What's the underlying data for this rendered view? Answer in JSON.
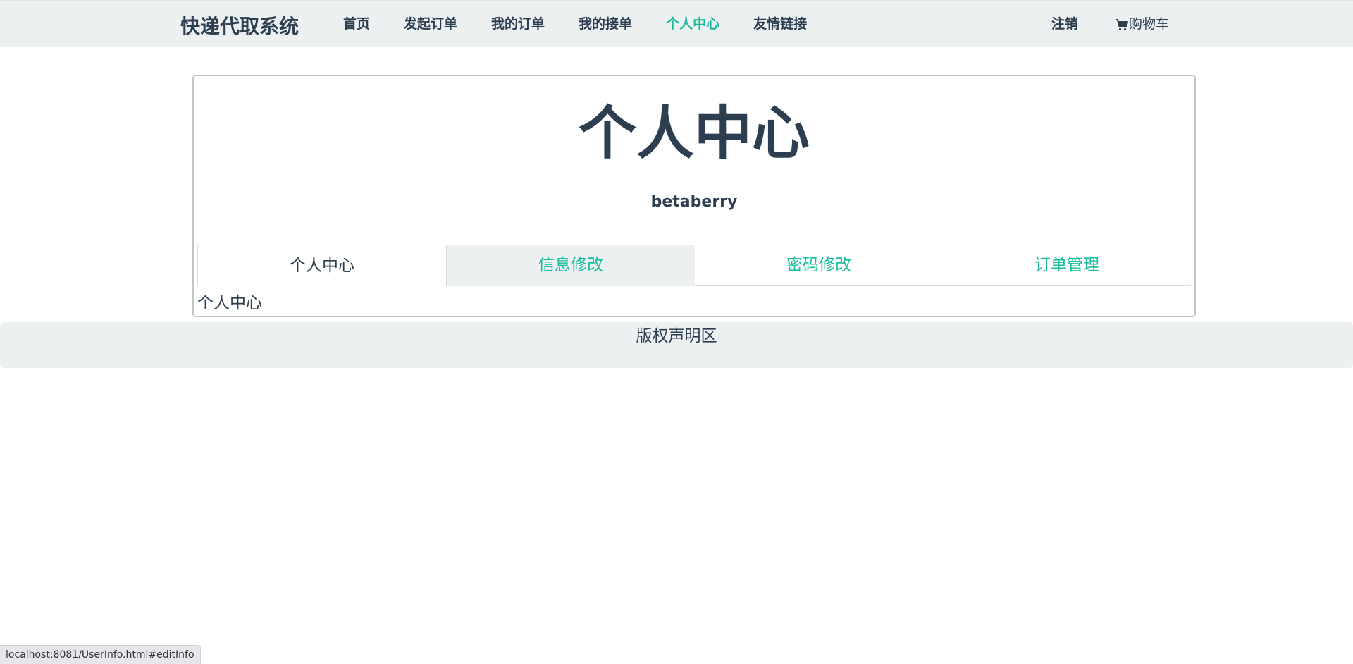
{
  "navbar": {
    "brand": "快递代取系统",
    "links": [
      {
        "label": "首页"
      },
      {
        "label": "发起订单"
      },
      {
        "label": "我的订单"
      },
      {
        "label": "我的接单"
      },
      {
        "label": "个人中心",
        "active": true
      },
      {
        "label": "友情链接"
      }
    ],
    "logout_label": "注销",
    "cart_label": "购物车",
    "cart_icon": "shopping-cart-icon"
  },
  "panel": {
    "title": "个人中心",
    "username": "betaberry",
    "tabs": [
      {
        "label": "个人中心",
        "active": true
      },
      {
        "label": "信息修改"
      },
      {
        "label": "密码修改"
      },
      {
        "label": "订单管理"
      }
    ],
    "content": "个人中心"
  },
  "footer": {
    "text": "版权声明区"
  },
  "status_bar": {
    "url": "localhost:8081/UserInfo.html#editInfo"
  },
  "colors": {
    "primary_text": "#2c3e50",
    "accent": "#18bc9c",
    "nav_background": "#ecf0f1"
  }
}
